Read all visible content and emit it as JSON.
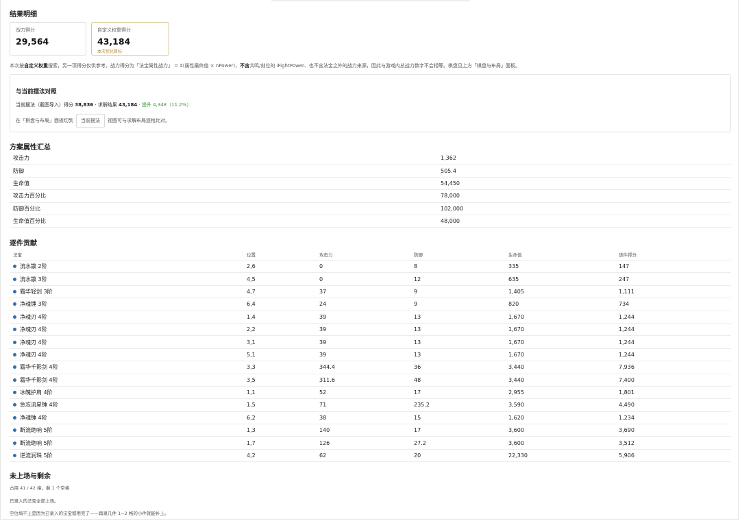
{
  "result": {
    "title": "结果明细",
    "cards": [
      {
        "label": "战力得分",
        "value": "29,564"
      },
      {
        "label": "自定义权重得分",
        "value": "43,184",
        "sub": "本次优化目标"
      }
    ],
    "note_pre": "本次按",
    "note_bold1": "自定义权重",
    "note_mid": "搜索，另一项得分仅供参考。战力得分为「法宝属性战力」 = Σ(属性最终值 × nPower)，",
    "note_bold2": "不含",
    "note_post": "共鸣/刻位的 iFightPower、也不含法宝之外的战力来源，因此与游戏内总战力数字不会相等。棋盘见上方「棋盘与布局」面板。"
  },
  "compare": {
    "title": "与当前摆法对照",
    "current_label": "当前摆法（截图导入）得分",
    "current_score": "38,836",
    "solve_label": "· 求解结果",
    "solve_score": "43,184",
    "gain": "· 提升 4,348（11.2%）",
    "hint_pre": "在「棋盘与布局」面板切到",
    "hint_button": "当前摆法",
    "hint_post": "视图可与求解布局逐格比对。"
  },
  "attributes": {
    "title": "方案属性汇总",
    "rows": [
      {
        "name": "攻击力",
        "value": "1,362"
      },
      {
        "name": "防御",
        "value": "505.4"
      },
      {
        "name": "生命值",
        "value": "54,450"
      },
      {
        "name": "攻击力百分比",
        "value": "78,000"
      },
      {
        "name": "防御百分比",
        "value": "102,000"
      },
      {
        "name": "生命值百分比",
        "value": "48,000"
      }
    ]
  },
  "contrib": {
    "title": "逐件贡献",
    "headers": [
      "法宝",
      "位置",
      "攻击力",
      "防御",
      "生命值",
      "该件得分"
    ],
    "dot_color": "#2f6fb0",
    "rows": [
      [
        "流水散 2阶",
        "2,6",
        "0",
        "8",
        "335",
        "147"
      ],
      [
        "流水散 3阶",
        "4,5",
        "0",
        "12",
        "635",
        "247"
      ],
      [
        "霜华轻剑 3阶",
        "4,7",
        "37",
        "9",
        "1,405",
        "1,111"
      ],
      [
        "净魂锤 3阶",
        "6,4",
        "24",
        "9",
        "820",
        "734"
      ],
      [
        "净魂刃 4阶",
        "1,4",
        "39",
        "13",
        "1,670",
        "1,244"
      ],
      [
        "净魂刃 4阶",
        "2,2",
        "39",
        "13",
        "1,670",
        "1,244"
      ],
      [
        "净魂刃 4阶",
        "3,1",
        "39",
        "13",
        "1,670",
        "1,244"
      ],
      [
        "净魂刃 4阶",
        "5,1",
        "39",
        "13",
        "1,670",
        "1,244"
      ],
      [
        "霜华千影剑 4阶",
        "3,3",
        "344.4",
        "36",
        "3,440",
        "7,936"
      ],
      [
        "霜华千影剑 4阶",
        "3,5",
        "311.6",
        "48",
        "3,440",
        "7,400"
      ],
      [
        "冰魄护肩 4阶",
        "1,1",
        "52",
        "17",
        "2,955",
        "1,801"
      ],
      [
        "急冻流星锤 4阶",
        "1,5",
        "71",
        "235.2",
        "3,590",
        "4,490"
      ],
      [
        "净魂锤 4阶",
        "6,2",
        "38",
        "15",
        "1,620",
        "1,234"
      ],
      [
        "断流绝响 5阶",
        "1,3",
        "140",
        "17",
        "3,600",
        "3,690"
      ],
      [
        "断流绝响 5阶",
        "1,7",
        "126",
        "27.2",
        "3,600",
        "3,512"
      ],
      [
        "逆流润珠 5阶",
        "4,2",
        "62",
        "20",
        "22,330",
        "5,906"
      ]
    ]
  },
  "remaining": {
    "title": "未上场与剩余",
    "occupancy": "占用 41 / 42 格，剩 1 个空格",
    "line1": "已录入的法宝全部上场。",
    "line2": "空位填不上是因为已录入的法宝都用完了——再录几件 1~2 格的小件就能补上。"
  }
}
